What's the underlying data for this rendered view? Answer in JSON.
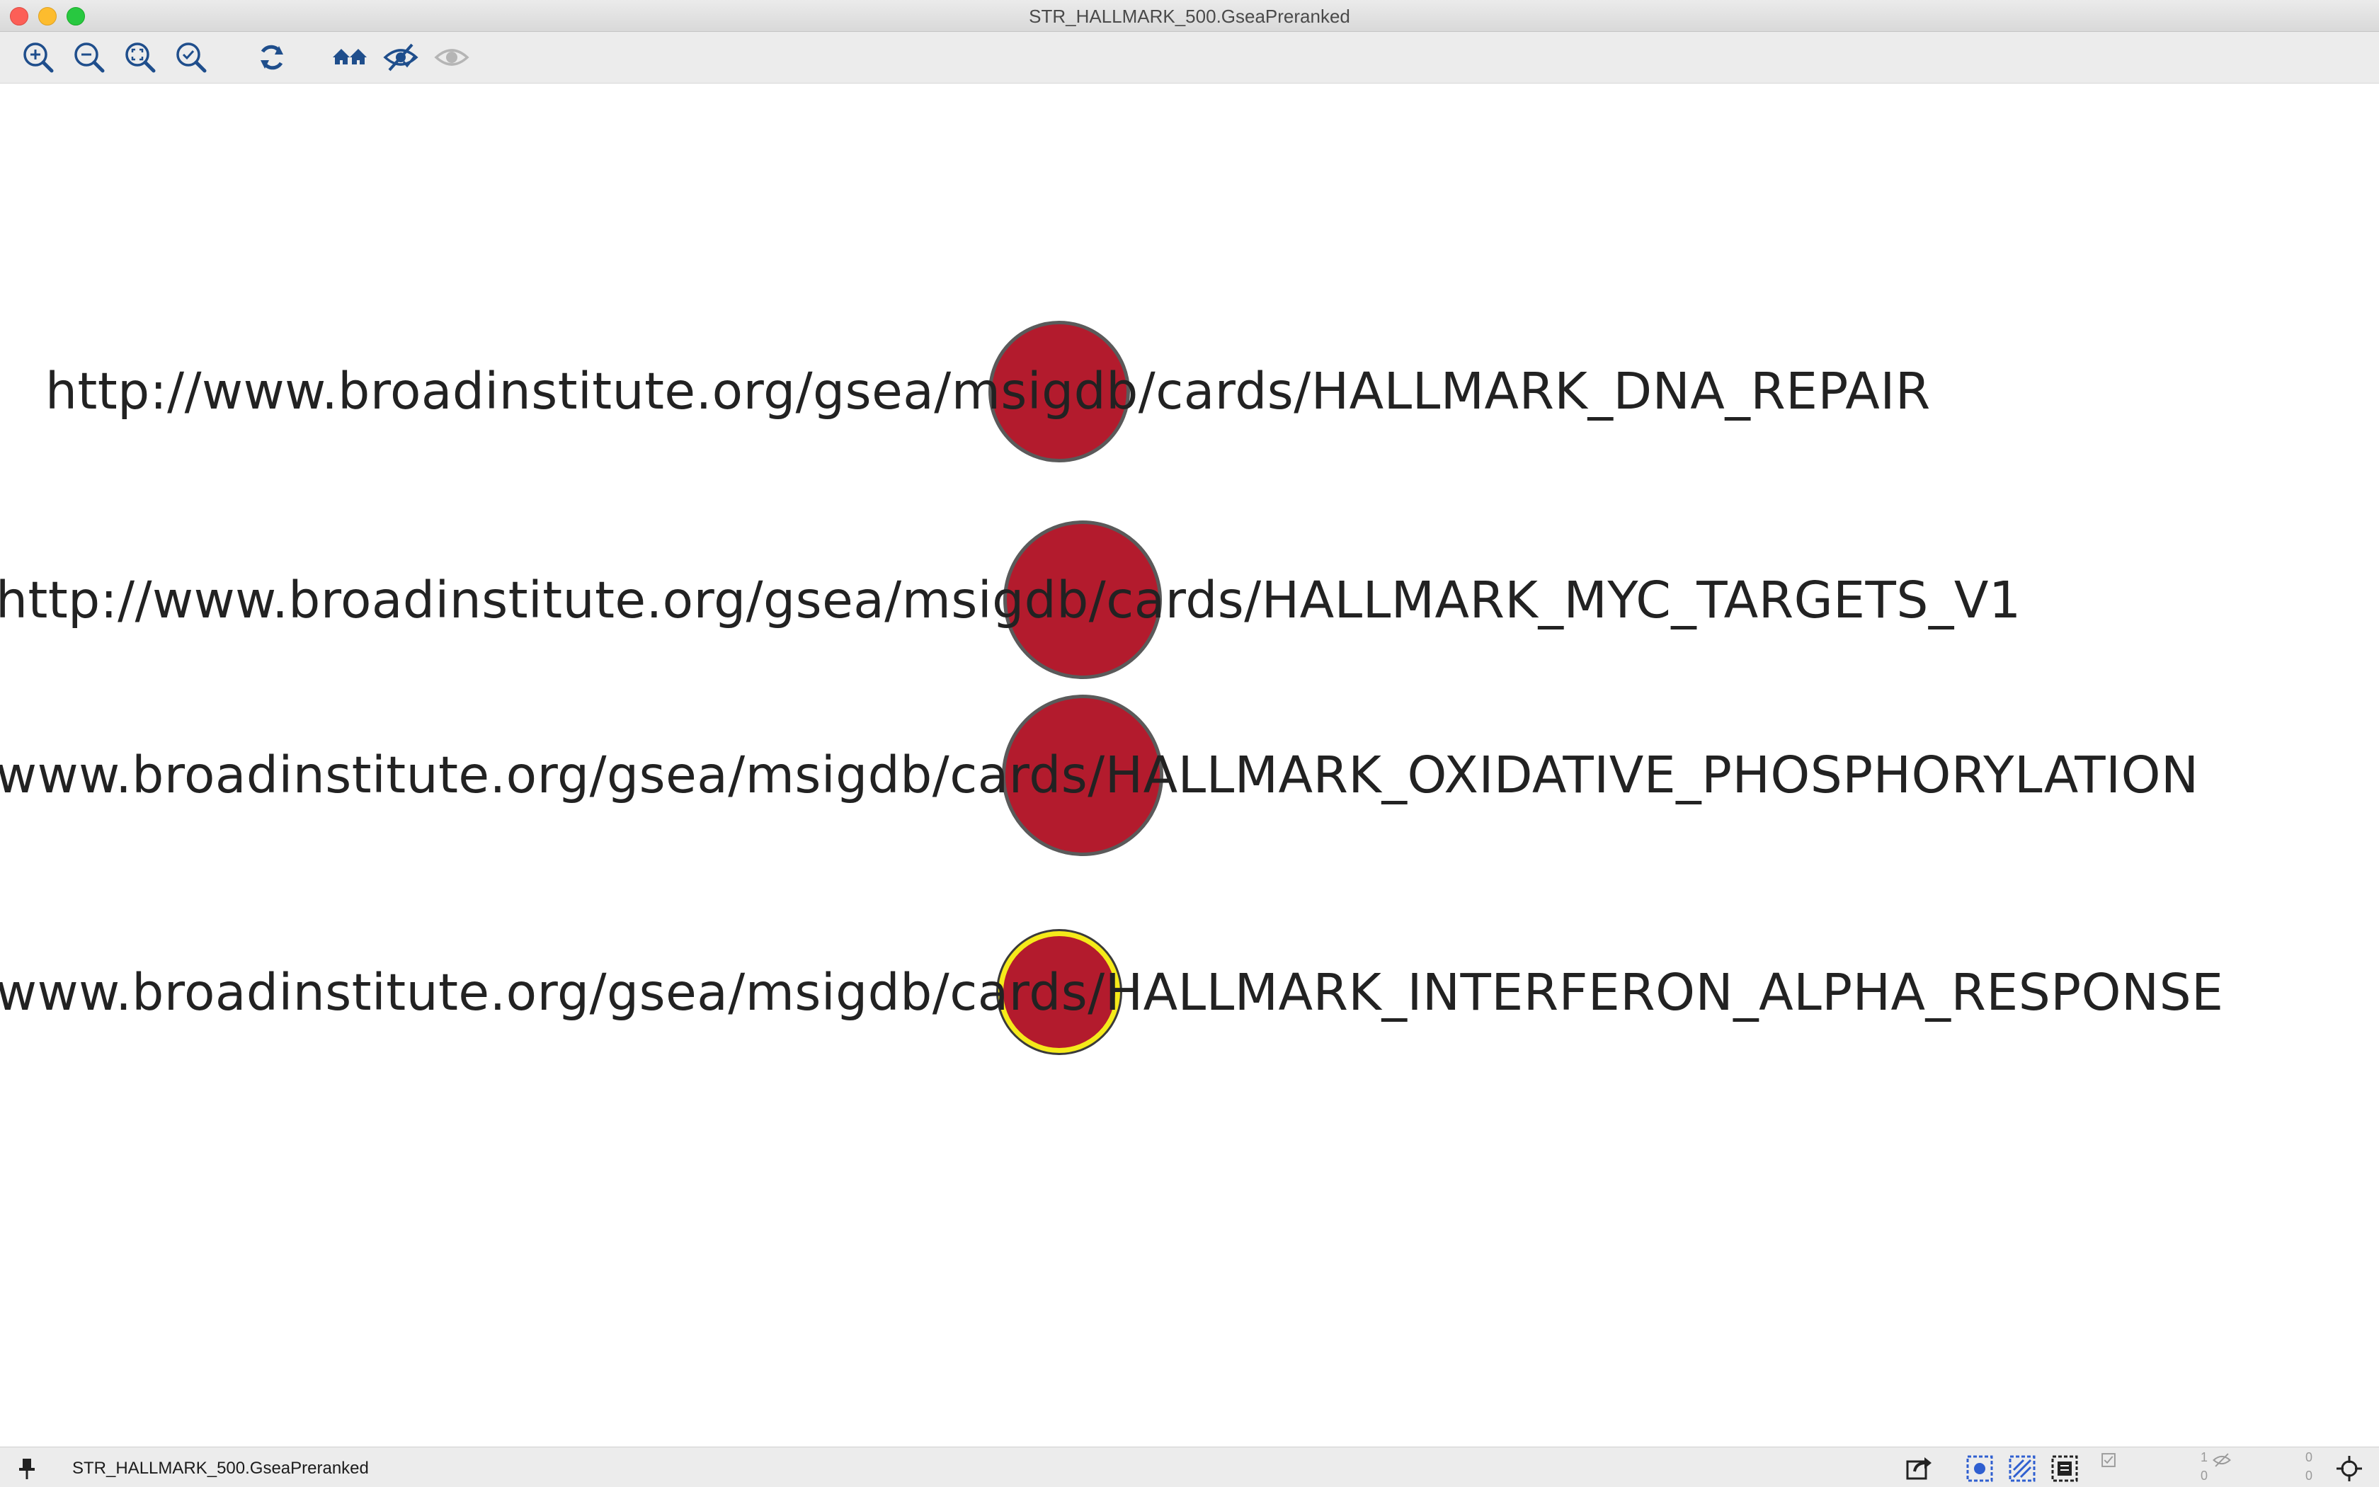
{
  "window": {
    "title": "STR_HALLMARK_500.GseaPreranked"
  },
  "toolbar": {
    "buttons": [
      {
        "name": "zoom-in",
        "icon": "zoom-in-icon"
      },
      {
        "name": "zoom-out",
        "icon": "zoom-out-icon"
      },
      {
        "name": "zoom-fit",
        "icon": "zoom-fit-icon"
      },
      {
        "name": "zoom-selected",
        "icon": "zoom-selected-icon"
      },
      {
        "name": "refresh",
        "icon": "refresh-icon"
      },
      {
        "name": "show-all",
        "icon": "home-icon"
      },
      {
        "name": "hide-selected",
        "icon": "hide-icon"
      },
      {
        "name": "show-hidden",
        "icon": "eye-icon"
      }
    ]
  },
  "network": {
    "node_color": "#b31b2d",
    "selected_border_color": "#f5ea1a",
    "nodes": [
      {
        "label": "http://www.broadinstitute.org/gsea/msigdb/cards/HALLMARK_DNA_REPAIR",
        "selected": false
      },
      {
        "label": "http://www.broadinstitute.org/gsea/msigdb/cards/HALLMARK_MYC_TARGETS_V1",
        "selected": false
      },
      {
        "label": "www.broadinstitute.org/gsea/msigdb/cards/HALLMARK_OXIDATIVE_PHOSPHORYLATION",
        "selected": false
      },
      {
        "label": "www.broadinstitute.org/gsea/msigdb/cards/HALLMARK_INTERFERON_ALPHA_RESPONSE",
        "selected": true
      }
    ]
  },
  "statusbar": {
    "network_name": "STR_HALLMARK_500.GseaPreranked",
    "selected_nodes": "1",
    "total_nodes_hidden": "0",
    "selected_edges": "0",
    "hidden_edges": "0"
  }
}
